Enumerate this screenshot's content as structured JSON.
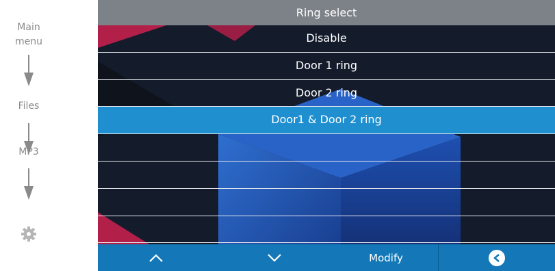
{
  "breadcrumb": {
    "items": [
      "Main\nmenu",
      "Files",
      "MP3"
    ],
    "icons": [
      "arrow-down-icon",
      "arrow-down-icon",
      "arrow-down-icon",
      "gear-icon"
    ]
  },
  "header": {
    "title": "Ring select"
  },
  "list": {
    "items": [
      {
        "label": "Disable",
        "selected": false
      },
      {
        "label": "Door 1 ring",
        "selected": false
      },
      {
        "label": "Door 2 ring",
        "selected": false
      },
      {
        "label": "Door1 & Door 2 ring",
        "selected": true
      },
      {
        "label": "",
        "selected": false
      },
      {
        "label": "",
        "selected": false
      },
      {
        "label": "",
        "selected": false
      },
      {
        "label": "",
        "selected": false
      }
    ]
  },
  "toolbar": {
    "up_icon": "chevron-up-icon",
    "down_icon": "chevron-down-icon",
    "modify_label": "Modify",
    "back_icon": "back-circle-icon"
  },
  "colors": {
    "title_bar": "#7d8289",
    "selected_row": "#1f8fd0",
    "bottom_bar": "#1478b8",
    "breadcrumb_text": "#8a8a8a"
  }
}
